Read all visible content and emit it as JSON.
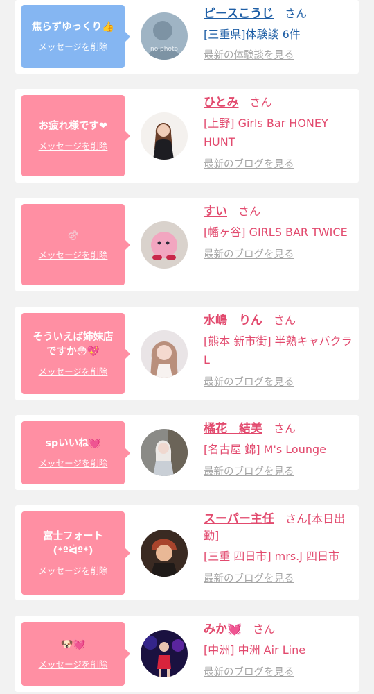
{
  "colors": {
    "pink": "#ff8fa3",
    "blue": "#85b6f2",
    "name_pink": "#e24a6e",
    "name_blue": "#1f5fa6",
    "link_gray": "#a6a6a6"
  },
  "delete_label": "メッセージを削除",
  "san_label": "さん",
  "items": [
    {
      "message": "焦らずゆっくり👍",
      "name": "ピースこうじ",
      "san": "さん",
      "shop": "[三重県]体験談 6件",
      "link": "最新の体験談を見る",
      "bubble_color": "blue",
      "avatar": "no-photo-avatar",
      "avatar_text": "no photo"
    },
    {
      "message": "お疲れ様です❤",
      "name": "ひとみ",
      "san": "さん",
      "shop": "[上野] Girls Bar HONEY HUNT",
      "link": "最新のブログを見る",
      "bubble_color": "pink",
      "avatar": "woman-photo-avatar"
    },
    {
      "message": "⚣",
      "name": "すい",
      "san": "さん",
      "shop": "[幡ヶ谷] GIRLS BAR TWICE",
      "link": "最新のブログを見る",
      "bubble_color": "pink",
      "avatar": "plush-photo-avatar"
    },
    {
      "message": "そういえば姉妹店ですか😳💖",
      "name": "水嶋　りん",
      "san": "さん",
      "shop": "[熊本 新市街] 半熟キャバクラ L",
      "link": "最新のブログを見る",
      "bubble_color": "pink",
      "avatar": "woman-photo-avatar"
    },
    {
      "message": "spいいね💓",
      "name": "橘花　結美",
      "san": "さん",
      "shop": "[名古屋 錦] M's Lounge",
      "link": "最新のブログを見る",
      "bubble_color": "pink",
      "avatar": "woman-photo-avatar"
    },
    {
      "message": "富士フォート(*ºᐛº*)",
      "name": "スーパー主任",
      "san": "さん[本日出勤]",
      "shop": "[三重 四日市] mrs.J 四日市",
      "link": "最新のブログを見る",
      "bubble_color": "pink",
      "avatar": "man-photo-avatar"
    },
    {
      "message": "🐶💓",
      "name": "みか💓",
      "san": "さん",
      "shop": "[中洲] 中洲 Air Line",
      "link": "最新のブログを見る",
      "bubble_color": "pink",
      "avatar": "woman-photo-avatar"
    }
  ]
}
